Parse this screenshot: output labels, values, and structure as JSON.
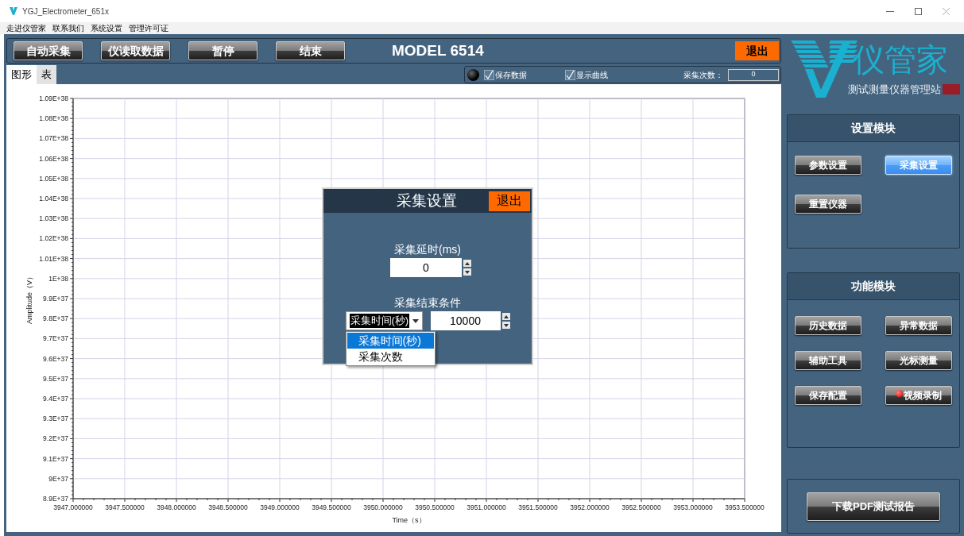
{
  "window": {
    "title": "YGJ_Electrometer_651x"
  },
  "menu": [
    "走进仪管家",
    "联系我们",
    "系统设置",
    "管理许可证"
  ],
  "toolbar": {
    "buttons": [
      "自动采集",
      "仪读取数据",
      "暂停",
      "结束"
    ],
    "model": "MODEL 6514",
    "exit": "退出"
  },
  "tabs": [
    {
      "label": "图形",
      "selected": true
    },
    {
      "label": "表",
      "selected": false
    }
  ],
  "status": {
    "led_on": false,
    "checkboxes": [
      {
        "label": "保存数据",
        "checked": true
      },
      {
        "label": "显示曲线",
        "checked": true
      }
    ],
    "count_label": "采集次数：",
    "count": "0"
  },
  "chart": {
    "chart_data": {
      "type": "line",
      "grid": true,
      "xlabel": "Time（s）",
      "ylabel": "Amplitude（V）",
      "xlim": [
        3947,
        3953.5
      ],
      "ylim": [
        8.9e+37,
        1.09e+38
      ],
      "xticks": [
        {
          "value": 3947,
          "label": "3947.000000"
        },
        {
          "value": 3947.5,
          "label": "3947.500000"
        },
        {
          "value": 3948,
          "label": "3948.000000"
        },
        {
          "value": 3948.5,
          "label": "3948.500000"
        },
        {
          "value": 3949,
          "label": "3949.000000"
        },
        {
          "value": 3949.5,
          "label": "3949.500000"
        },
        {
          "value": 3950,
          "label": "3950.000000"
        },
        {
          "value": 3950.5,
          "label": "3950.500000"
        },
        {
          "value": 3951,
          "label": "3951.000000"
        },
        {
          "value": 3951.5,
          "label": "3951.500000"
        },
        {
          "value": 3952,
          "label": "3952.000000"
        },
        {
          "value": 3952.5,
          "label": "3952.500000"
        },
        {
          "value": 3953,
          "label": "3953.000000"
        },
        {
          "value": 3953.5,
          "label": "3953.500000"
        }
      ],
      "yticks": [
        {
          "value": 8.9e+37,
          "label": "8.9E+37"
        },
        {
          "value": 9e+37,
          "label": "9E+37"
        },
        {
          "value": 9.1e+37,
          "label": "9.1E+37"
        },
        {
          "value": 9.2e+37,
          "label": "9.2E+37"
        },
        {
          "value": 9.3e+37,
          "label": "9.3E+37"
        },
        {
          "value": 9.4e+37,
          "label": "9.4E+37"
        },
        {
          "value": 9.5e+37,
          "label": "9.5E+37"
        },
        {
          "value": 9.6e+37,
          "label": "9.6E+37"
        },
        {
          "value": 9.7e+37,
          "label": "9.7E+37"
        },
        {
          "value": 9.8e+37,
          "label": "9.8E+37"
        },
        {
          "value": 9.9e+37,
          "label": "9.9E+37"
        },
        {
          "value": 1e+38,
          "label": "1E+38"
        },
        {
          "value": 1.01e+38,
          "label": "1.01E+38"
        },
        {
          "value": 1.02e+38,
          "label": "1.02E+38"
        },
        {
          "value": 1.03e+38,
          "label": "1.03E+38"
        },
        {
          "value": 1.04e+38,
          "label": "1.04E+38"
        },
        {
          "value": 1.05e+38,
          "label": "1.05E+38"
        },
        {
          "value": 1.06e+38,
          "label": "1.06E+38"
        },
        {
          "value": 1.07e+38,
          "label": "1.07E+38"
        },
        {
          "value": 1.08e+38,
          "label": "1.08E+38"
        },
        {
          "value": 1.09e+38,
          "label": "1.09E+38"
        }
      ]
    }
  },
  "dialog": {
    "title": "采集设置",
    "exit": "退出",
    "delay_label": "采集延时(ms)",
    "delay": "0",
    "end_label": "采集结束条件",
    "mode": "采集时间(秒)",
    "options": [
      {
        "label": "采集时间(秒)",
        "selected": true
      },
      {
        "label": "采集次数",
        "selected": false
      }
    ],
    "end_value": "10000"
  },
  "logo": {
    "name": "仪管家",
    "tagline": "测试测量仪器管理站"
  },
  "settings_panel": {
    "title": "设置模块",
    "buttons": [
      {
        "label": "参数设置",
        "selected": false
      },
      {
        "label": "采集设置",
        "selected": true
      },
      {
        "label": "重置仪器",
        "selected": false
      }
    ]
  },
  "function_panel": {
    "title": "功能模块",
    "buttons": [
      {
        "label": "历史数据",
        "kind": "plain"
      },
      {
        "label": "异常数据",
        "kind": "plain"
      },
      {
        "label": "辅助工具",
        "kind": "plain"
      },
      {
        "label": "光标测量",
        "kind": "plain"
      },
      {
        "label": "保存配置",
        "kind": "plain"
      },
      {
        "label": "视频录制",
        "kind": "record"
      }
    ]
  },
  "report_button": "下载PDF测试报告"
}
